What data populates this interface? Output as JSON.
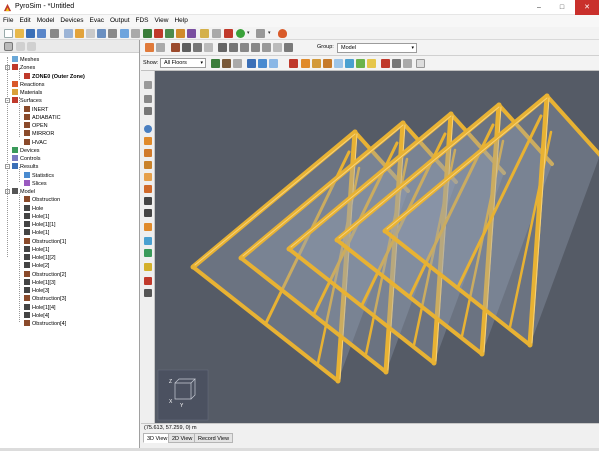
{
  "window": {
    "title": "PyroSim - *Untitled",
    "minimize": "–",
    "maximize": "□",
    "close": "✕"
  },
  "menu": [
    "File",
    "Edit",
    "Model",
    "Devices",
    "Evac",
    "Output",
    "FDS",
    "View",
    "Help"
  ],
  "toolbar": {
    "icons": [
      "new-icon",
      "open-icon",
      "save-icon",
      "save-as-icon",
      "print-icon",
      "cut-icon",
      "copy-icon",
      "paste-icon",
      "delete-icon",
      "record-icon",
      "filter-icon",
      "grid-icon",
      "move-icon",
      "rotate-icon",
      "copy-move-icon",
      "mirror-icon",
      "scale-icon",
      "run-icon",
      "dropdown-icon",
      "run-settings-icon",
      "stop-icon",
      "fire-icon"
    ]
  },
  "view_toolbar": {
    "group_label": "Group:",
    "group_value": "Model",
    "show_label": "Show:",
    "show_value": "All Floors"
  },
  "tree": {
    "nodes": [
      {
        "label": "Meshes",
        "icon": "mesh-icon",
        "level": 1
      },
      {
        "label": "Zones",
        "icon": "zones-icon",
        "level": 1,
        "toggle": "−"
      },
      {
        "label": "ZONE0 (Outer Zone)",
        "icon": "zone-icon",
        "level": 2,
        "bold": true
      },
      {
        "label": "Reactions",
        "icon": "reaction-icon",
        "level": 1
      },
      {
        "label": "Materials",
        "icon": "material-icon",
        "level": 1
      },
      {
        "label": "Surfaces",
        "icon": "surfaces-icon",
        "level": 1,
        "toggle": "−"
      },
      {
        "label": "INERT",
        "icon": "surface-icon",
        "level": 2
      },
      {
        "label": "ADIABATIC",
        "icon": "surface-icon",
        "level": 2
      },
      {
        "label": "OPEN",
        "icon": "surface-icon",
        "level": 2
      },
      {
        "label": "MIRROR",
        "icon": "surface-icon",
        "level": 2
      },
      {
        "label": "HVAC",
        "icon": "surface-icon",
        "level": 2
      },
      {
        "label": "Devices",
        "icon": "devices-icon",
        "level": 1
      },
      {
        "label": "Controls",
        "icon": "controls-icon",
        "level": 1
      },
      {
        "label": "Results",
        "icon": "results-icon",
        "level": 1,
        "toggle": "−"
      },
      {
        "label": "Statistics",
        "icon": "statistics-icon",
        "level": 2
      },
      {
        "label": "Slices",
        "icon": "slices-icon",
        "level": 2
      },
      {
        "label": "Model",
        "icon": "model-icon",
        "level": 1,
        "toggle": "−"
      },
      {
        "label": "Obstruction",
        "icon": "obstruction-icon",
        "level": 2
      },
      {
        "label": "Hole",
        "icon": "hole-icon",
        "level": 2
      },
      {
        "label": "Hole[1]",
        "icon": "hole-icon",
        "level": 2
      },
      {
        "label": "Hole[1][1]",
        "icon": "hole-icon",
        "level": 2
      },
      {
        "label": "Hole[1]",
        "icon": "hole-icon",
        "level": 2
      },
      {
        "label": "Obstruction[1]",
        "icon": "obstruction-icon",
        "level": 2
      },
      {
        "label": "Hole[1]",
        "icon": "hole-icon",
        "level": 2
      },
      {
        "label": "Hole[1][2]",
        "icon": "hole-icon",
        "level": 2
      },
      {
        "label": "Hole[2]",
        "icon": "hole-icon",
        "level": 2
      },
      {
        "label": "Obstruction[2]",
        "icon": "obstruction-icon",
        "level": 2
      },
      {
        "label": "Hole[1][3]",
        "icon": "hole-icon",
        "level": 2
      },
      {
        "label": "Hole[3]",
        "icon": "hole-icon",
        "level": 2
      },
      {
        "label": "Obstruction[3]",
        "icon": "obstruction-icon",
        "level": 2
      },
      {
        "label": "Hole[1][4]",
        "icon": "hole-icon",
        "level": 2
      },
      {
        "label": "Hole[4]",
        "icon": "hole-icon",
        "level": 2
      },
      {
        "label": "Obstruction[4]",
        "icon": "obstruction-icon",
        "level": 2
      }
    ]
  },
  "viewport": {
    "background": "#555b66",
    "truss_color": "#e8b233",
    "axis_labels": {
      "x": "X",
      "y": "Y",
      "z": "Z"
    }
  },
  "status": {
    "coords": "(75.613, 57.259, 0) m"
  },
  "tabs": [
    "3D View",
    "2D View",
    "Record View"
  ],
  "colors": {
    "accent": "#3a6fb7",
    "close": "#c9302c",
    "red_icon": "#c0392b"
  }
}
